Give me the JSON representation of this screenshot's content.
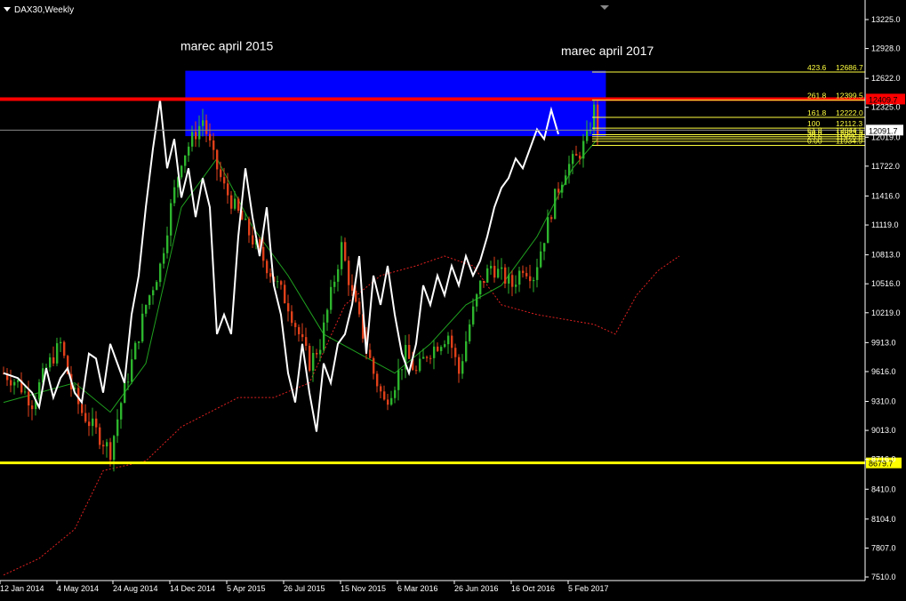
{
  "window": {
    "symbol_title": "DAX30,Weekly"
  },
  "colors": {
    "background": "#000000",
    "bull": "#2db52d",
    "bear": "#e0401a",
    "line": "#ffffff",
    "dashed": "#e02020",
    "ma": "#1fa01f",
    "zone": "#0000ff",
    "resistance": "#ff0000",
    "support": "#ffff00",
    "fib": "#ffff40",
    "axis_text": "#ffffff"
  },
  "chart_data": {
    "type": "candlestick",
    "title": "DAX30,Weekly",
    "ylim": [
      7410,
      13410
    ],
    "y_ticks": [
      13225.0,
      12928.0,
      12622.0,
      12325.0,
      12019.0,
      11722.0,
      11416.0,
      11119.0,
      10813.0,
      10516.0,
      10219.0,
      9913.0,
      9616.0,
      9310.0,
      9013.0,
      8716.0,
      8410.0,
      8104.0,
      7807.0,
      7510.0
    ],
    "x_labels": [
      "12 Jan 2014",
      "4 May 2014",
      "24 Aug 2014",
      "14 Dec 2014",
      "5 Apr 2015",
      "26 Jul 2015",
      "15 Nov 2015",
      "6 Mar 2016",
      "26 Jun 2016",
      "16 Oct 2016",
      "5 Feb 2017"
    ],
    "annotations": [
      {
        "text": "marec april 2015",
        "x_index": 4,
        "price": 12940
      },
      {
        "text": "marec april 2017",
        "x_index": 10,
        "price": 12890
      }
    ],
    "zone": {
      "price_top": 12700,
      "price_bottom": 12030,
      "from_index": 3.5,
      "to_index": 11.6
    },
    "horizontal_lines": [
      {
        "price": 12409.7,
        "label": "12409.7",
        "style": "resistance"
      },
      {
        "price": 8679.7,
        "label": "8679.7",
        "style": "support"
      },
      {
        "price": 12091.7,
        "label": "12091.7",
        "style": "current"
      }
    ],
    "fibonacci": [
      {
        "level": "423.6",
        "price": "12686.7",
        "value": 12686.7
      },
      {
        "level": "261.8",
        "price": "12399.5",
        "value": 12399.5
      },
      {
        "level": "161.8",
        "price": "12222.0",
        "value": 12222.0
      },
      {
        "level": "100",
        "price": "12112.3",
        "value": 12112.3
      },
      {
        "level": "61.8",
        "price": "12044.5",
        "value": 12044.5
      },
      {
        "level": "50.0",
        "price": "12023.6",
        "value": 12023.6
      },
      {
        "level": "38.2",
        "price": "12002.7",
        "value": 12002.7
      },
      {
        "level": "23.6",
        "price": "11976.8",
        "value": 11976.8
      },
      {
        "level": "0.00",
        "price": "11934.9",
        "value": 11934.9
      }
    ],
    "candle_count": 168,
    "candle_anchors": [
      [
        0,
        9600
      ],
      [
        4,
        9500
      ],
      [
        8,
        9300
      ],
      [
        12,
        9650
      ],
      [
        16,
        9900
      ],
      [
        19,
        9450
      ],
      [
        22,
        9200
      ],
      [
        26,
        9000
      ],
      [
        30,
        8800
      ],
      [
        33,
        9300
      ],
      [
        37,
        9850
      ],
      [
        40,
        10300
      ],
      [
        44,
        10700
      ],
      [
        47,
        11300
      ],
      [
        50,
        11800
      ],
      [
        53,
        12000
      ],
      [
        56,
        12200
      ],
      [
        59,
        11800
      ],
      [
        62,
        11500
      ],
      [
        65,
        11300
      ],
      [
        68,
        11100
      ],
      [
        71,
        10900
      ],
      [
        74,
        10700
      ],
      [
        77,
        10500
      ],
      [
        80,
        10300
      ],
      [
        83,
        10000
      ],
      [
        86,
        9700
      ],
      [
        89,
        9900
      ],
      [
        92,
        10400
      ],
      [
        95,
        10900
      ],
      [
        98,
        10400
      ],
      [
        101,
        10000
      ],
      [
        104,
        9600
      ],
      [
        107,
        9300
      ],
      [
        110,
        9500
      ],
      [
        113,
        9800
      ],
      [
        116,
        9600
      ],
      [
        119,
        9800
      ],
      [
        122,
        9900
      ],
      [
        125,
        10000
      ],
      [
        128,
        9600
      ],
      [
        131,
        10100
      ],
      [
        134,
        10500
      ],
      [
        137,
        10700
      ],
      [
        140,
        10600
      ],
      [
        143,
        10500
      ],
      [
        146,
        10700
      ],
      [
        149,
        10600
      ],
      [
        152,
        11000
      ],
      [
        155,
        11400
      ],
      [
        158,
        11700
      ],
      [
        161,
        11800
      ],
      [
        164,
        12000
      ],
      [
        166,
        12300
      ],
      [
        167,
        12090
      ]
    ],
    "white_line": [
      [
        0,
        9600
      ],
      [
        4,
        9550
      ],
      [
        8,
        9400
      ],
      [
        10,
        9250
      ],
      [
        12,
        9650
      ],
      [
        14,
        9350
      ],
      [
        16,
        9550
      ],
      [
        18,
        9650
      ],
      [
        20,
        9400
      ],
      [
        22,
        9300
      ],
      [
        24,
        9800
      ],
      [
        26,
        9750
      ],
      [
        28,
        9400
      ],
      [
        30,
        9900
      ],
      [
        32,
        9700
      ],
      [
        34,
        9500
      ],
      [
        36,
        10200
      ],
      [
        38,
        10600
      ],
      [
        40,
        11300
      ],
      [
        42,
        11900
      ],
      [
        44,
        12400
      ],
      [
        46,
        11700
      ],
      [
        48,
        12000
      ],
      [
        50,
        11400
      ],
      [
        52,
        11700
      ],
      [
        54,
        11200
      ],
      [
        56,
        11600
      ],
      [
        58,
        11300
      ],
      [
        60,
        10000
      ],
      [
        62,
        10200
      ],
      [
        64,
        10000
      ],
      [
        66,
        11000
      ],
      [
        68,
        11700
      ],
      [
        70,
        11200
      ],
      [
        72,
        10800
      ],
      [
        74,
        11300
      ],
      [
        76,
        10500
      ],
      [
        78,
        10200
      ],
      [
        80,
        9600
      ],
      [
        82,
        9300
      ],
      [
        84,
        9900
      ],
      [
        86,
        9400
      ],
      [
        88,
        9000
      ],
      [
        90,
        9700
      ],
      [
        92,
        9500
      ],
      [
        94,
        9900
      ],
      [
        96,
        10000
      ],
      [
        98,
        10300
      ],
      [
        100,
        10800
      ],
      [
        102,
        9800
      ],
      [
        104,
        10600
      ],
      [
        106,
        10300
      ],
      [
        108,
        10700
      ],
      [
        110,
        10200
      ],
      [
        112,
        9800
      ],
      [
        114,
        9600
      ],
      [
        116,
        9900
      ],
      [
        118,
        10500
      ],
      [
        120,
        10300
      ],
      [
        122,
        10600
      ],
      [
        124,
        10400
      ],
      [
        126,
        10700
      ],
      [
        128,
        10500
      ],
      [
        130,
        10800
      ],
      [
        132,
        10600
      ],
      [
        134,
        10750
      ],
      [
        136,
        11000
      ],
      [
        138,
        11300
      ],
      [
        140,
        11500
      ],
      [
        142,
        11600
      ],
      [
        144,
        11800
      ],
      [
        146,
        11700
      ],
      [
        148,
        11900
      ],
      [
        150,
        12100
      ],
      [
        152,
        12000
      ],
      [
        154,
        12300
      ],
      [
        156,
        12050
      ]
    ],
    "white_line_end_index": 156,
    "ma_line": [
      [
        0,
        9300
      ],
      [
        10,
        9400
      ],
      [
        20,
        9500
      ],
      [
        30,
        9200
      ],
      [
        40,
        9700
      ],
      [
        50,
        11300
      ],
      [
        60,
        11800
      ],
      [
        70,
        11100
      ],
      [
        80,
        10600
      ],
      [
        90,
        10000
      ],
      [
        100,
        9800
      ],
      [
        110,
        9600
      ],
      [
        120,
        9900
      ],
      [
        130,
        10300
      ],
      [
        140,
        10500
      ],
      [
        150,
        11000
      ],
      [
        160,
        11700
      ],
      [
        167,
        12000
      ]
    ],
    "dashed_line": [
      [
        0,
        7530
      ],
      [
        10,
        7700
      ],
      [
        20,
        8000
      ],
      [
        28,
        8600
      ],
      [
        40,
        8700
      ],
      [
        50,
        9050
      ],
      [
        58,
        9200
      ],
      [
        66,
        9350
      ],
      [
        76,
        9350
      ],
      [
        86,
        9500
      ],
      [
        96,
        10300
      ],
      [
        106,
        10600
      ],
      [
        116,
        10700
      ],
      [
        124,
        10800
      ],
      [
        132,
        10700
      ],
      [
        140,
        10300
      ],
      [
        150,
        10200
      ],
      [
        158,
        10150
      ],
      [
        166,
        10100
      ],
      [
        172,
        10000
      ],
      [
        178,
        10400
      ],
      [
        184,
        10650
      ],
      [
        190,
        10800
      ]
    ]
  }
}
